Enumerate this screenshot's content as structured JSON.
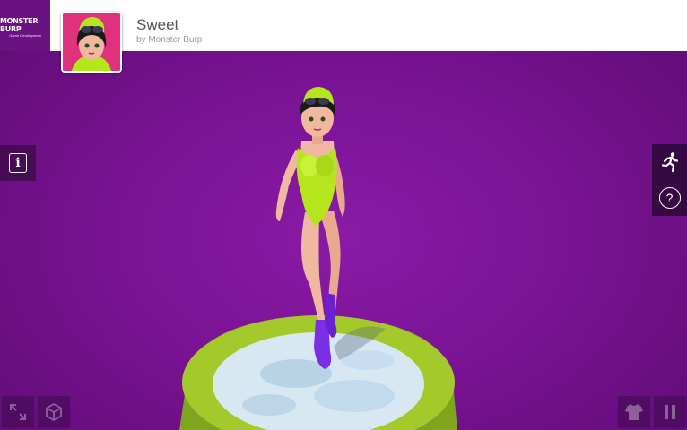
{
  "header": {
    "logo_text": "MONSTER BURP",
    "logo_subtext": "Game Development",
    "title": "Sweet",
    "byline": "by Monster Burp"
  },
  "controls": {
    "info_label": "i",
    "help_label": "?"
  },
  "icons": {
    "info": "info-icon",
    "run": "running-figure-icon",
    "help": "question-icon",
    "fullscreen": "fullscreen-icon",
    "vr": "vr-cube-icon",
    "outfit": "shirt-icon",
    "pause": "pause-icon"
  },
  "colors": {
    "background": "#7a1394",
    "header": "#ffffff",
    "swimsuit": "#b5e61d",
    "fins": "#7a2ee6",
    "pedestal": "#9cc22a"
  }
}
